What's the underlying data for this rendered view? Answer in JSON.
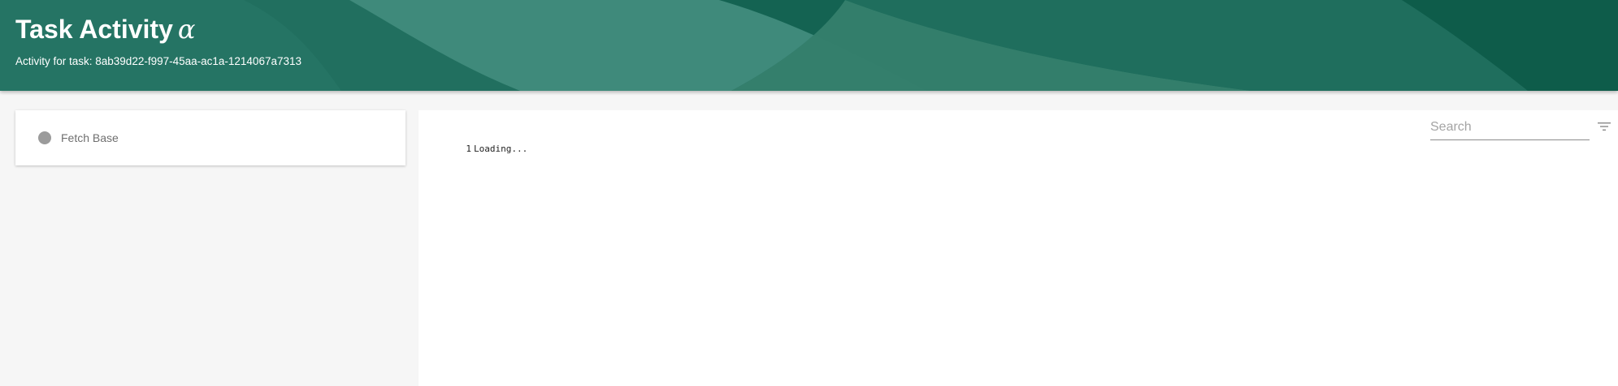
{
  "header": {
    "title": "Task Activity",
    "title_symbol": "α",
    "subtitle": "Activity for task: 8ab39d22-f997-45aa-ac1a-1214067a7313",
    "colors": {
      "base": "#1c6b5b",
      "dark": "#0e5c4a",
      "light": "#3f8a7b"
    }
  },
  "steps": [
    {
      "label": "Fetch Base",
      "status_color": "#9b9b9b"
    }
  ],
  "search": {
    "placeholder": "Search",
    "value": ""
  },
  "filter_icon": "filter-list-icon",
  "log": {
    "lines": [
      {
        "number": "1",
        "text": "Loading..."
      }
    ]
  }
}
